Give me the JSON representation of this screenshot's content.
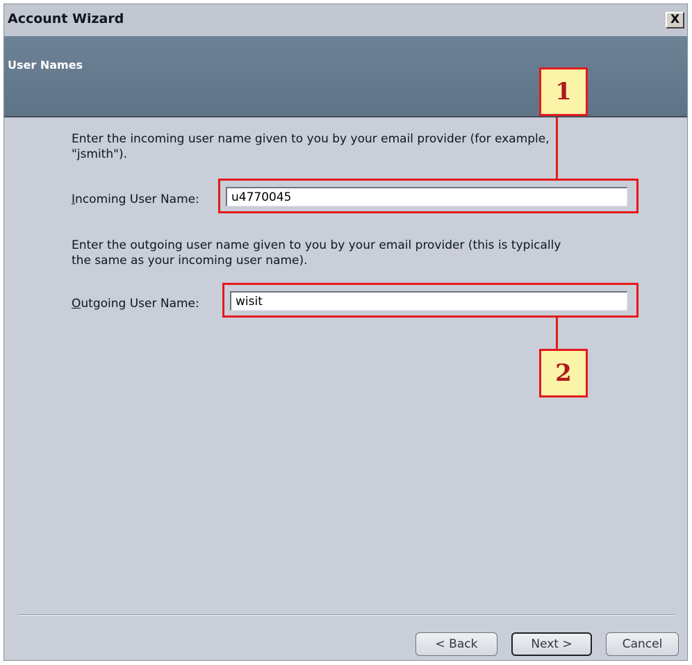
{
  "window": {
    "title": "Account Wizard",
    "close_label": "X"
  },
  "header": {
    "title": "User Names"
  },
  "incoming": {
    "description": "Enter the incoming user name given to you by your email provider (for example,\n\"jsmith\").",
    "label_mnemonic": "I",
    "label_rest": "ncoming User Name:",
    "value": "u4770045"
  },
  "outgoing": {
    "description": "Enter the outgoing user name given to you by your email provider (this is typically\nthe same as your incoming user name).",
    "label_mnemonic": "O",
    "label_rest": "utgoing User Name:",
    "value": "wisit"
  },
  "callouts": {
    "first": "1",
    "second": "2"
  },
  "buttons": {
    "back": "< Back",
    "next": "Next >",
    "cancel": "Cancel"
  },
  "colors": {
    "header_band": "#6e8296",
    "callout_border": "#e5191c",
    "callout_fill": "#fbf3a8",
    "dialog_background": "#c9ced8"
  }
}
